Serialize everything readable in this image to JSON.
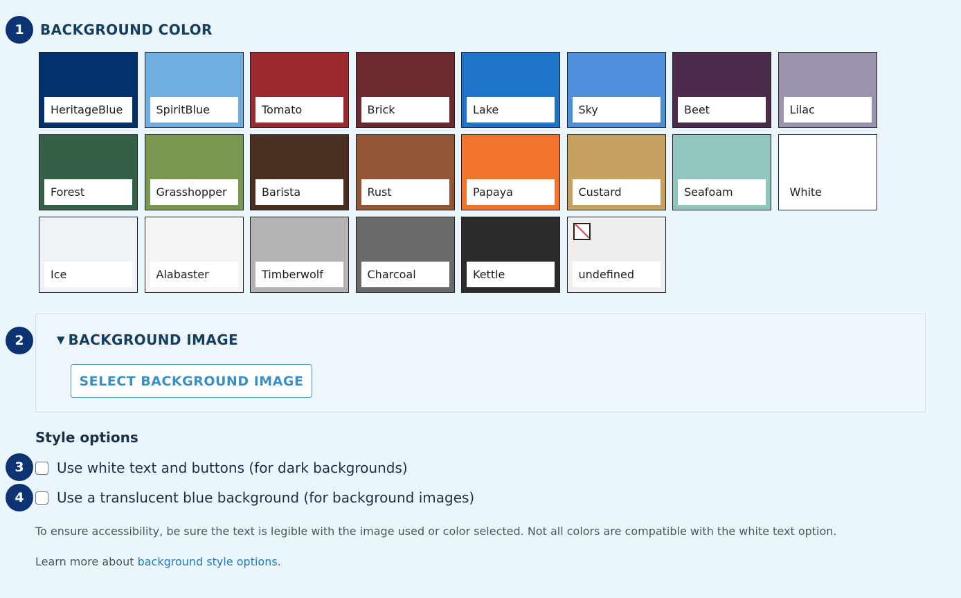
{
  "steps": [
    "1",
    "2",
    "3",
    "4"
  ],
  "background_color": {
    "title": "BACKGROUND COLOR",
    "swatches": [
      {
        "label": "HeritageBlue",
        "color": "#023170"
      },
      {
        "label": "SpiritBlue",
        "color": "#70ade0"
      },
      {
        "label": "Tomato",
        "color": "#9b2b31"
      },
      {
        "label": "Brick",
        "color": "#6e292e"
      },
      {
        "label": "Lake",
        "color": "#1e74c8"
      },
      {
        "label": "Sky",
        "color": "#4e8fdb"
      },
      {
        "label": "Beet",
        "color": "#4c2b4d"
      },
      {
        "label": "Lilac",
        "color": "#9b92ae"
      },
      {
        "label": "Forest",
        "color": "#325f45"
      },
      {
        "label": "Grasshopper",
        "color": "#7a9751"
      },
      {
        "label": "Barista",
        "color": "#4a2e21"
      },
      {
        "label": "Rust",
        "color": "#925536"
      },
      {
        "label": "Papaya",
        "color": "#f2742b"
      },
      {
        "label": "Custard",
        "color": "#c5a25f"
      },
      {
        "label": "Seafoam",
        "color": "#92c5bc"
      },
      {
        "label": "White",
        "color": "#ffffff"
      },
      {
        "label": "Ice",
        "color": "#eff2f7"
      },
      {
        "label": "Alabaster",
        "color": "#f5f5f4"
      },
      {
        "label": "Timberwolf",
        "color": "#b4b4b4"
      },
      {
        "label": "Charcoal",
        "color": "#6a6a6a"
      },
      {
        "label": "Kettle",
        "color": "#2b2b2b"
      },
      {
        "label": "undefined",
        "color": "#efefef",
        "icon": "broken-image-icon"
      }
    ]
  },
  "background_image": {
    "title": "BACKGROUND IMAGE",
    "toggle_icon": "triangle-down-icon",
    "toggle_glyph": "▼",
    "select_button_label": "SELECT BACKGROUND IMAGE"
  },
  "style_options": {
    "heading": "Style options",
    "options": [
      {
        "label": "Use white text and buttons (for dark backgrounds)",
        "checked": false
      },
      {
        "label": "Use a translucent blue background (for background images)",
        "checked": false
      }
    ],
    "accessibility_note": "To ensure accessibility, be sure the text is legible with the image used or color selected. Not all colors are compatible with the white text option.",
    "learn_more_prefix": "Learn more about ",
    "learn_more_link": "background style options",
    "learn_more_suffix": "."
  },
  "colors": {
    "page_background": "#ebf5fc",
    "step_badge": "#0d3472",
    "section_title": "#153f5e",
    "link": "#1e7ab8",
    "button_border": "#3a93c7"
  }
}
